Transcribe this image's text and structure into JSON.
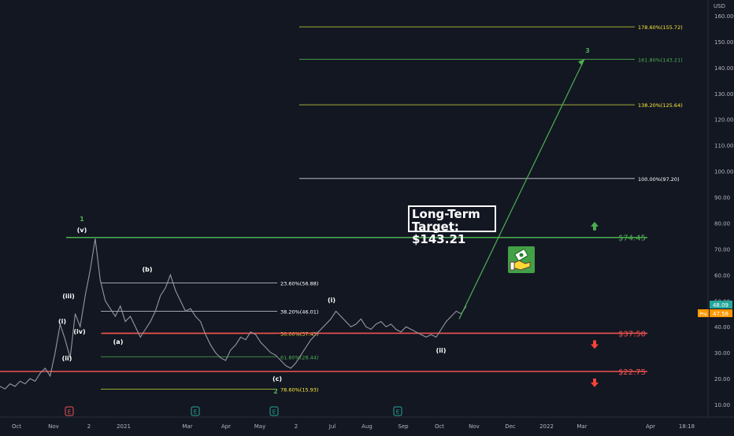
{
  "chart_data": {
    "type": "line",
    "currency": "USD",
    "y_ticks": [
      10,
      20,
      30,
      40,
      50,
      60,
      70,
      80,
      90,
      100,
      110,
      120,
      130,
      140,
      150,
      160
    ],
    "x_ticks": [
      "Oct",
      "Nov",
      "2",
      "2021",
      "Mar",
      "Apr",
      "May",
      "2",
      "Jul",
      "Aug",
      "Sep",
      "Oct",
      "Nov",
      "Dec",
      "2022",
      "Mar",
      "Apr",
      "18:18"
    ],
    "price_series": {
      "name": "price",
      "values": [
        17,
        16,
        18,
        17,
        19,
        18,
        20,
        19,
        22,
        24,
        21,
        30,
        41,
        35,
        28,
        45,
        40,
        52,
        62,
        74,
        58,
        50,
        47,
        44,
        48,
        42,
        44,
        40,
        36,
        39,
        42,
        46,
        52,
        55,
        60,
        54,
        50,
        46,
        47,
        44,
        42,
        37,
        33,
        30,
        28,
        27,
        31,
        33,
        36,
        35,
        38,
        37,
        34,
        32,
        30,
        29,
        27,
        25,
        24,
        26,
        29,
        32,
        35,
        37,
        39,
        41,
        43,
        46,
        44,
        42,
        40,
        41,
        43,
        40,
        39,
        41,
        42,
        40,
        41,
        39,
        38,
        40,
        39,
        38,
        37,
        36,
        37,
        36,
        39,
        42,
        44,
        46,
        45,
        48
      ]
    },
    "fib_retracements": [
      {
        "label": "23.60%(56.88)",
        "value": 56.88
      },
      {
        "label": "38.20%(46.01)",
        "value": 46.01
      },
      {
        "label": "50.00%(37.43)",
        "value": 37.43
      },
      {
        "label": "61.80%(28.44)",
        "value": 28.44
      },
      {
        "label": "78.60%(15.93)",
        "value": 15.93
      }
    ],
    "fib_extensions": [
      {
        "label": "178.60%(155.72)",
        "value": 155.72
      },
      {
        "label": "161.80%(143.21)",
        "value": 143.21
      },
      {
        "label": "138.20%(125.64)",
        "value": 125.64
      },
      {
        "label": "100.00%(97.20)",
        "value": 97.2
      }
    ],
    "levels": [
      {
        "label": "$74.45",
        "value": 74.45,
        "color": "#4caf50",
        "arrow": "up"
      },
      {
        "label": "$37.50",
        "value": 37.5,
        "color": "#ef5350",
        "arrow": "down"
      },
      {
        "label": "$22.75",
        "value": 22.75,
        "color": "#ef5350",
        "arrow": "down"
      }
    ],
    "wave_labels": [
      "1",
      "(v)",
      "(iii)",
      "(i)",
      "(iv)",
      "(ii)",
      "(b)",
      "(a)",
      "(c)",
      "2",
      "(i)",
      "(ii)",
      "3"
    ],
    "annotation": {
      "line1": "Long-Term Target:",
      "line2": "$143.21"
    },
    "projection": {
      "from": 43,
      "to": 143.21
    },
    "price_tags": [
      {
        "label": "48.09",
        "color": "#26a69a"
      },
      {
        "label": "47.58",
        "tag": "Pre",
        "color": "#ff9800"
      }
    ],
    "earnings_markers": [
      "E",
      "E",
      "E",
      "E"
    ],
    "ylim": [
      0,
      165
    ]
  }
}
